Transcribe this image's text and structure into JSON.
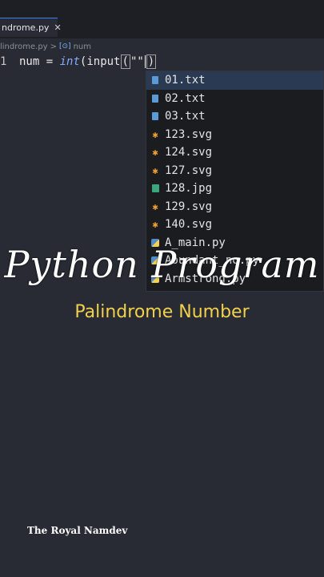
{
  "tab": {
    "label": "ndrome.py",
    "close": "✕"
  },
  "breadcrumb": {
    "file": "lindrome.py",
    "sep": ">",
    "symbol_icon": "[⊙]",
    "symbol": "num"
  },
  "editor": {
    "line_number": "1",
    "tokens": {
      "var": "num",
      "op": "=",
      "fn_int": "int",
      "fn_input": "input",
      "open_paren": "(",
      "str": "\"\"",
      "close_paren": ")"
    }
  },
  "suggestions": [
    {
      "label": "01.txt",
      "icon": "file-icon"
    },
    {
      "label": "02.txt",
      "icon": "file-icon"
    },
    {
      "label": "03.txt",
      "icon": "file-icon"
    },
    {
      "label": "123.svg",
      "icon": "svg-icon"
    },
    {
      "label": "124.svg",
      "icon": "svg-icon"
    },
    {
      "label": "127.svg",
      "icon": "svg-icon"
    },
    {
      "label": "128.jpg",
      "icon": "image-icon"
    },
    {
      "label": "129.svg",
      "icon": "svg-icon"
    },
    {
      "label": "140.svg",
      "icon": "svg-icon"
    },
    {
      "label": "A_main.py",
      "icon": "python-icon"
    },
    {
      "label": "Abundant_no.py",
      "icon": "python-icon"
    },
    {
      "label": "Armstrong.py",
      "icon": "python-icon"
    }
  ],
  "overlay": {
    "title": "Python Program",
    "subtitle": "Palindrome Number",
    "watermark": "The Royal Namdev"
  },
  "colors": {
    "background": "#282a34",
    "selection": "#2a3a52",
    "subtitle": "#f2d14a",
    "accent": "#3b82f6"
  }
}
